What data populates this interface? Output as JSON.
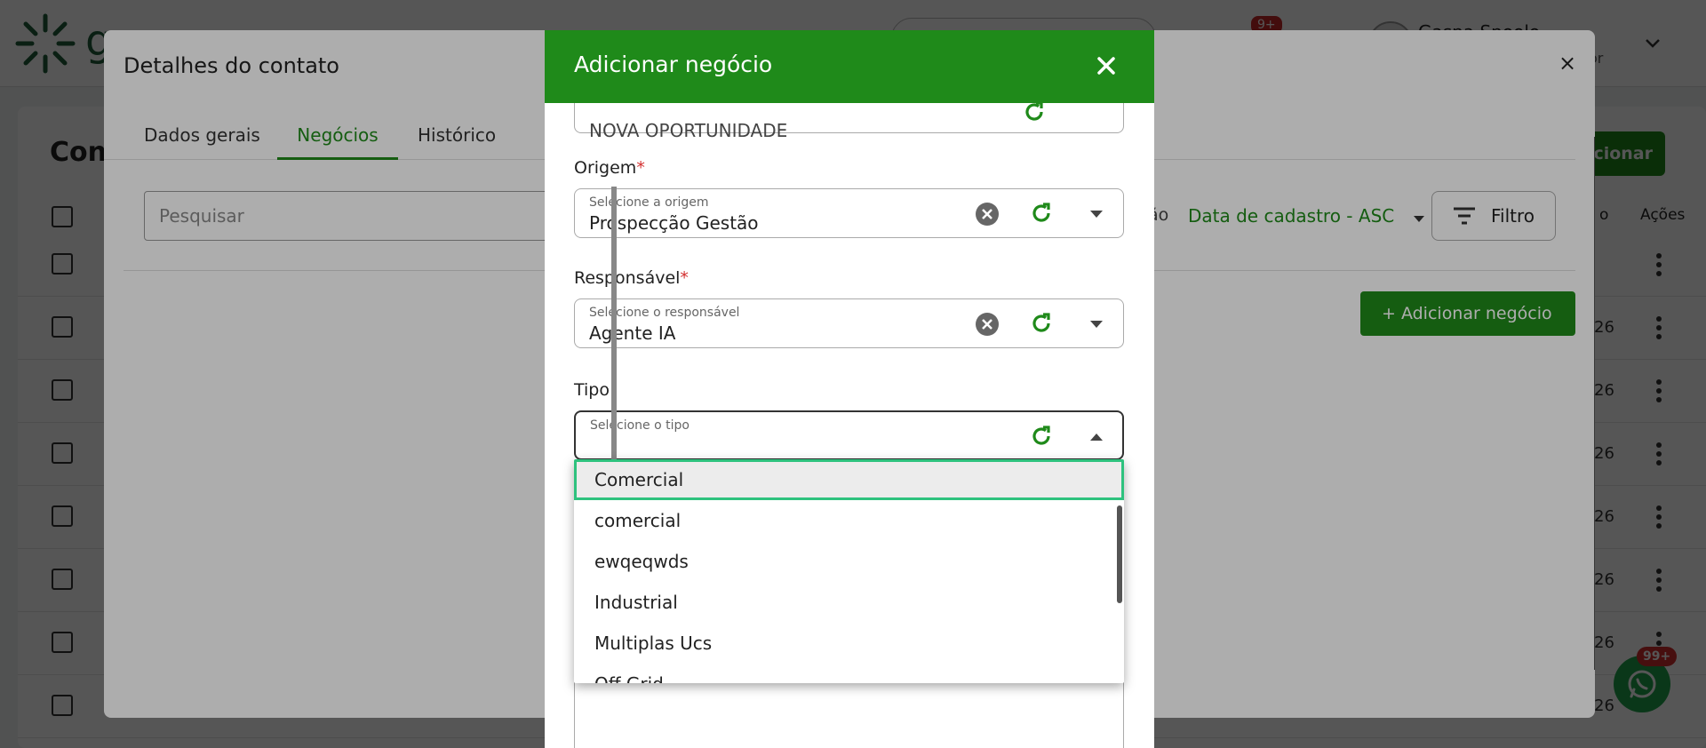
{
  "background_app": {
    "logo_text": "g",
    "page_title": "Con",
    "add_button_partial": "cionar",
    "notification_count": "9+",
    "user_name": "Gaspa Spoolo",
    "user_role": "ador",
    "column_head_actions": "Ações",
    "column_head_partial": "o",
    "row_dates": [
      "",
      "26",
      "26",
      "26",
      "26",
      "26",
      "26",
      "26"
    ],
    "whatsapp_badge": "99+"
  },
  "contact_dialog": {
    "title": "Detalhes do contato",
    "close_label": "×",
    "tabs": [
      {
        "label": "Dados gerais"
      },
      {
        "label": "Negócios"
      },
      {
        "label": "Histórico"
      }
    ],
    "search_placeholder": "Pesquisar",
    "sort_label_partial": "ão",
    "sort_value": "Data de cadastro - ASC",
    "filter_label": "Filtro",
    "add_deal_label": "+ Adicionar negócio"
  },
  "deal_dialog": {
    "title": "Adicionar negócio",
    "cut_field_value": "NOVA OPORTUNIDADE",
    "origem": {
      "label": "Origem",
      "required_mark": "*",
      "mini_label": "Selecione a origem",
      "value": "Prospecção Gestão"
    },
    "responsavel": {
      "label": "Responsável",
      "required_mark": "*",
      "mini_label": "Selecione o responsável",
      "value": "Agente IA"
    },
    "tipo": {
      "label": "Tipo",
      "mini_label": "Selecione o tipo",
      "value": ""
    }
  },
  "dropdown": {
    "options": [
      "Comercial",
      "comercial",
      "ewqeqwds",
      "Industrial",
      "Multiplas Ucs",
      "Off Grid"
    ],
    "highlighted_index": 0
  },
  "colors": {
    "brand_green": "#1f8a1a",
    "focus_ring": "#2ec27e",
    "required_red": "#d32f2f"
  }
}
